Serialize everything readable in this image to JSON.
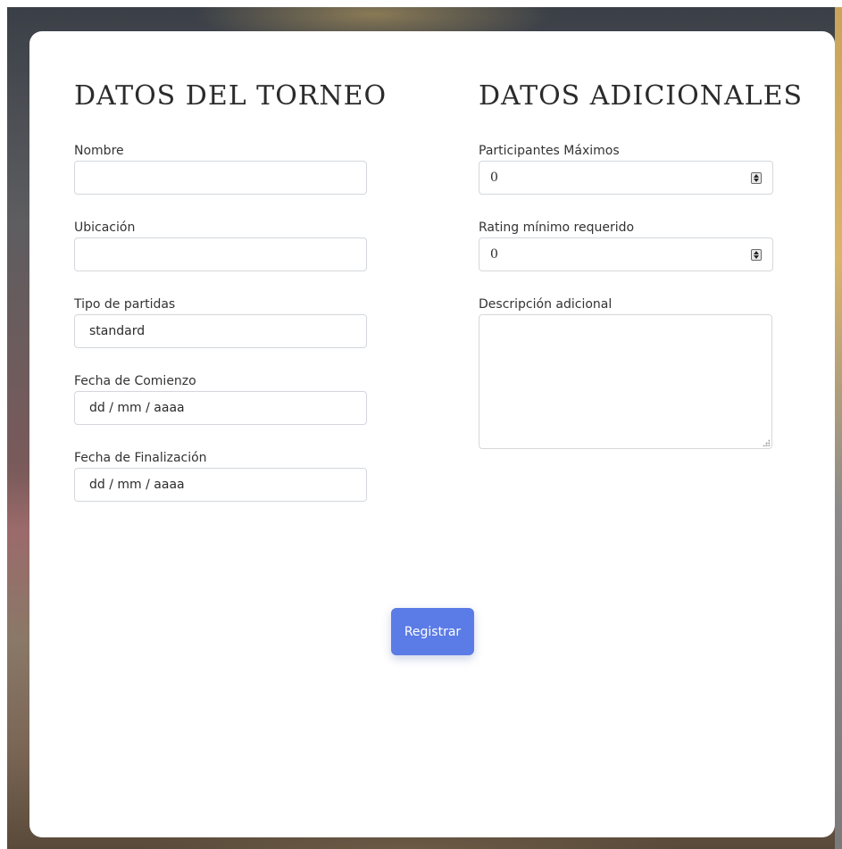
{
  "torneo": {
    "title": "DATOS DEL TORNEO",
    "nombre": {
      "label": "Nombre",
      "value": ""
    },
    "ubicacion": {
      "label": "Ubicación",
      "value": ""
    },
    "tipo_partidas": {
      "label": "Tipo de partidas",
      "value": "standard"
    },
    "fecha_comienzo": {
      "label": "Fecha de Comienzo",
      "value": "dd / mm / aaaa"
    },
    "fecha_finalizacion": {
      "label": "Fecha de Finalización",
      "value": "dd / mm / aaaa"
    }
  },
  "adicionales": {
    "title": "DATOS ADICIONALES",
    "participantes_maximos": {
      "label": "Participantes Máximos",
      "value": "0"
    },
    "rating_minimo": {
      "label": "Rating mínimo requerido",
      "value": "0"
    },
    "descripcion": {
      "label": "Descripción adicional",
      "value": ""
    }
  },
  "actions": {
    "submit_label": "Registrar"
  },
  "colors": {
    "button": "#5b7be6",
    "card": "#ffffff",
    "input_border": "#d4d8dc"
  },
  "icons": {
    "spinner": "number-spinner-icon",
    "resize": "resize-grip-icon"
  }
}
